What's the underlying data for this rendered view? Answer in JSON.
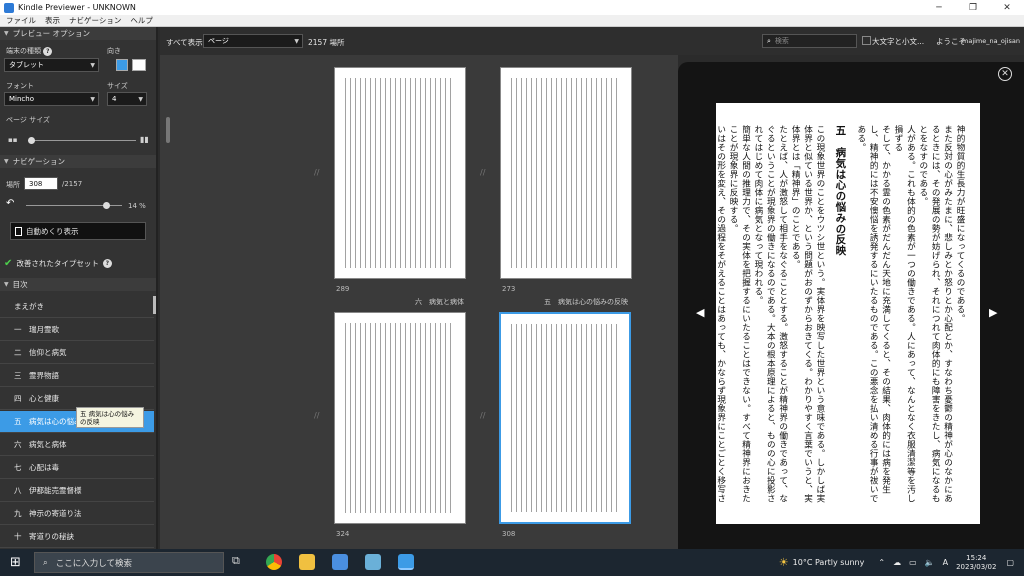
{
  "window": {
    "title": "Kindle Previewer - UNKNOWN"
  },
  "menu": [
    "ファイル",
    "表示",
    "ナビゲーション",
    "ヘルプ"
  ],
  "sidebar": {
    "preview_options": "プレビュー オプション",
    "device_type_label": "端末の種類",
    "device_type": "タブレット",
    "orientation_label": "向き",
    "font_label": "フォント",
    "font": "Mincho",
    "size_label": "サイズ",
    "size": "4",
    "page_size_label": "ページ サイズ",
    "navigation": "ナビゲーション",
    "location_label": "場所",
    "location_value": "308",
    "location_total": "/2157",
    "progress_fraction": 0.14,
    "progress_text": "14 %",
    "autoflip": "自動めくり表示",
    "typeset": "改善されたタイプセット",
    "toc": "目次",
    "toc_items": [
      "まえがき",
      "一　瑞月霊歌",
      "二　信仰と病気",
      "三　霊界物語",
      "四　心と健康",
      "五　病気は心の悩みの反映",
      "六　病気と病体",
      "七　心配は毒",
      "八　伊都能売霊督様",
      "九　神示の寄道り法",
      "十　寄道りの秘訣"
    ],
    "tooltip": "五 病気は心の悩みの反映"
  },
  "toolbar": {
    "show_all": "すべて表示",
    "view": "ページ",
    "locations": "2157 場所",
    "search_placeholder": "検索",
    "large_text": "大文字と小文...",
    "welcome": "ようこそ",
    "user": "majime_na_ojisan"
  },
  "thumbs": [
    {
      "num": "289",
      "chapter": ""
    },
    {
      "num": "273",
      "chapter": ""
    },
    {
      "num": "324",
      "chapter": "六　病気と病体"
    },
    {
      "num": "308",
      "chapter": "五　病気は心の悩みの反映"
    }
  ],
  "page_text": {
    "p1": "神的物質的生長力が旺盛になってくるのである。",
    "p2": "また反対の心がみたまに、悲しみとか怒りとか心配とか、すなわち憂鬱の精神が心のなかにあるときには、その発展の勢が妨げられ、それにつれて肉体的にも障害をきたし、病気になるもとをなすのである。",
    "p3": "人がある。これも体的の色素が一つの働きである。人にあって、なんとなく衣服清潔等を汚し損ずる",
    "p4": "そして、かかる霊の色素がだんだん天地に充満してくると、その結果、肉体的には病を発生し、精神的には不安懊悩を誘発するにいたるものである。この悪念を払い清める行事が祓いである。",
    "heading": "五　病気は心の悩みの反映",
    "p5": "この現象世界のことをウツシ世という。実体界を映写した世界という意味である。しかしば実体界と似ている世界か、という問題がおのずからおきてくる。わかりやすく言葉でいうと、実体界とは「精神界」のことである。",
    "p6": "たとえば、人が激怒して相手をなぐることとする。激怒することが精神界の働きであって、なぐるということが現象界の働きになるのである。大本の根本原理によると、ものの心に投影されてはじめて肉体に病気となって現われる。",
    "p7": "簡単な人間の推理力で、その実体を把握するにいたることはできない。すべて精神界におきたことが現象界に反映する。",
    "p8": "いはその形を変え、その過程をそがえることはあっても、かならず現象界にことごとく移写されるのである。"
  },
  "taskbar": {
    "search_placeholder": "ここに入力して検索",
    "weather": "10°C  Partly sunny",
    "time": "15:24",
    "date": "2023/03/02"
  }
}
